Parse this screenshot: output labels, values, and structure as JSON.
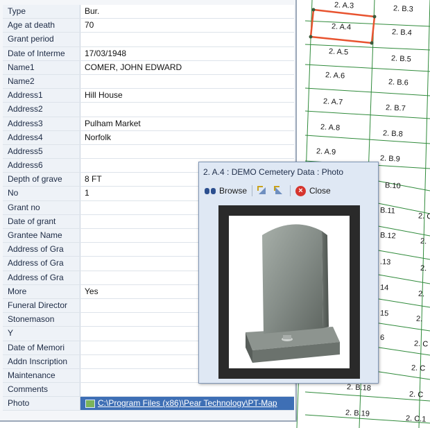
{
  "grid": {
    "rows": [
      {
        "label": "Type",
        "value": "Bur."
      },
      {
        "label": "Age at death",
        "value": "70"
      },
      {
        "label": "Grant period",
        "value": ""
      },
      {
        "label": "Date of Interme",
        "value": "17/03/1948"
      },
      {
        "label": "Name1",
        "value": "COMER, JOHN EDWARD"
      },
      {
        "label": "Name2",
        "value": ""
      },
      {
        "label": "Address1",
        "value": "Hill House"
      },
      {
        "label": "Address2",
        "value": ""
      },
      {
        "label": "Address3",
        "value": "Pulham Market"
      },
      {
        "label": "Address4",
        "value": "Norfolk"
      },
      {
        "label": "Address5",
        "value": ""
      },
      {
        "label": "Address6",
        "value": ""
      },
      {
        "label": "Depth of grave",
        "value": "8 FT"
      },
      {
        "label": "No",
        "value": "1"
      },
      {
        "label": "Grant no",
        "value": ""
      },
      {
        "label": "Date of grant",
        "value": ""
      },
      {
        "label": "Grantee Name",
        "value": ""
      },
      {
        "label": "Address of Gra",
        "value": ""
      },
      {
        "label": "Address of Gra",
        "value": ""
      },
      {
        "label": "Address of Gra",
        "value": ""
      },
      {
        "label": "More",
        "value": "Yes"
      },
      {
        "label": "Funeral Director",
        "value": ""
      },
      {
        "label": "Stonemason",
        "value": ""
      },
      {
        "label": "Y",
        "value": ""
      },
      {
        "label": "Date of Memori",
        "value": ""
      },
      {
        "label": "Addn Inscription",
        "value": ""
      },
      {
        "label": "Maintenance",
        "value": ""
      },
      {
        "label": "Comments",
        "value": ""
      },
      {
        "label": "Photo",
        "value": "C:\\Program Files (x86)\\Pear Technology\\PT-Map",
        "link": true
      }
    ]
  },
  "photo_window": {
    "title": "2. A.4 : DEMO Cemetery Data : Photo",
    "browse_label": "Browse",
    "close_label": "Close"
  },
  "map": {
    "plots": [
      "2. A.3",
      "2. B.3",
      "2. A.4",
      "2. B.4",
      "2. A.5",
      "2. B.5",
      "2. A.6",
      "2. B.6",
      "2. A.7",
      "2. B.7",
      "2. A.8",
      "2. B.8",
      "2. A.9",
      "2. B.9",
      "B.10",
      "B.11",
      "B.12",
      ".13",
      "14",
      "15",
      "6",
      "2. B.18",
      "2. B.19",
      "2. C",
      "2. C",
      "2. C",
      "2. C.1",
      "2.",
      "2.",
      "2.",
      "2.",
      "2. C"
    ],
    "selected_plot": "2. A.4",
    "colors": {
      "grid_line": "#2f8a3a",
      "selection": "#e8532f",
      "panel_link_bg": "#3e6fb5"
    }
  }
}
